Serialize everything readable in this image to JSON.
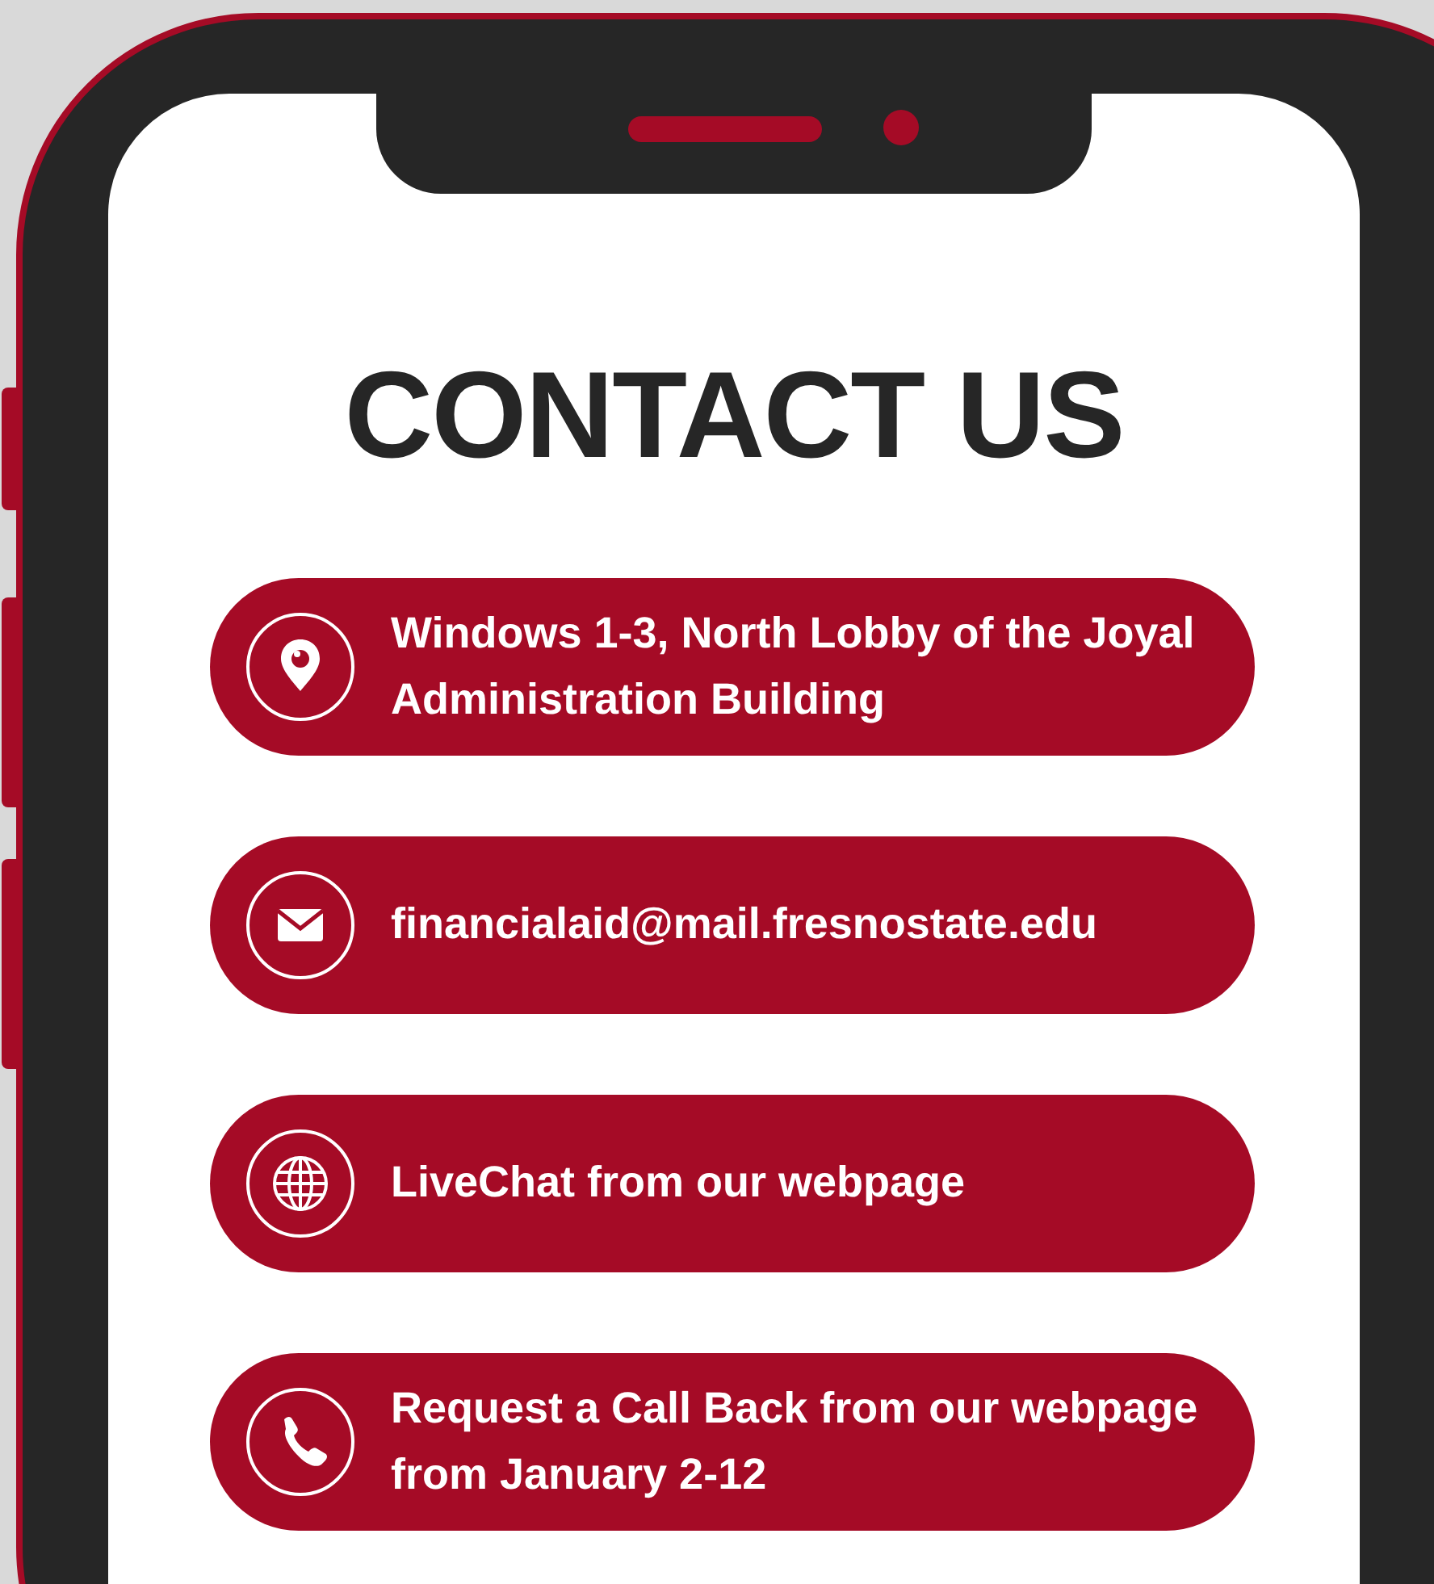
{
  "title": "CONTACT US",
  "contacts": [
    {
      "kind": "location",
      "text": "Windows 1-3, North Lobby of the Joyal Administration Building"
    },
    {
      "kind": "email",
      "text": "financialaid@mail.fresnostate.edu"
    },
    {
      "kind": "globe",
      "text": "LiveChat from our webpage"
    },
    {
      "kind": "phone",
      "text": "Request a Call Back from our webpage from January 2-12"
    }
  ]
}
